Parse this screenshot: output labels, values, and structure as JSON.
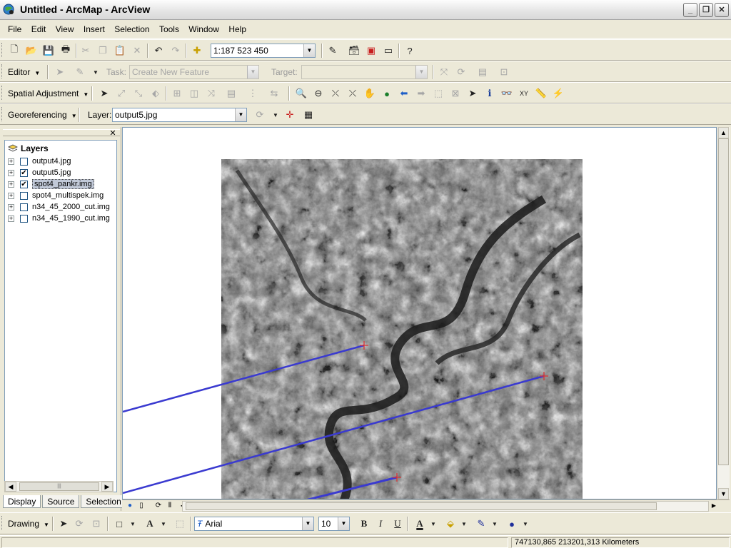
{
  "window": {
    "title": "Untitled - ArcMap - ArcView"
  },
  "window_controls": {
    "minimize": "_",
    "maximize": "❐",
    "close": "✕"
  },
  "menu": [
    "File",
    "Edit",
    "View",
    "Insert",
    "Selection",
    "Tools",
    "Window",
    "Help"
  ],
  "standard_toolbar": {
    "scale": "1:187 523 450"
  },
  "editor_toolbar": {
    "editor_label": "Editor",
    "task_label": "Task:",
    "task_value": "Create New Feature",
    "target_label": "Target:",
    "target_value": ""
  },
  "spatial_adjustment_toolbar": {
    "label": "Spatial Adjustment"
  },
  "georeferencing_toolbar": {
    "label": "Georeferencing",
    "layer_label": "Layer:",
    "layer_value": "output5.jpg"
  },
  "toc": {
    "root": "Layers",
    "layers": [
      {
        "name": "output4.jpg",
        "checked": false,
        "selected": false
      },
      {
        "name": "output5.jpg",
        "checked": true,
        "selected": false
      },
      {
        "name": "spot4_pankr.img",
        "checked": true,
        "selected": true
      },
      {
        "name": "spot4_multispek.img",
        "checked": false,
        "selected": false
      },
      {
        "name": "n34_45_2000_cut.img",
        "checked": false,
        "selected": false
      },
      {
        "name": "n34_45_1990_cut.img",
        "checked": false,
        "selected": false
      }
    ],
    "tabs": [
      "Display",
      "Source",
      "Selection"
    ],
    "active_tab": "Display"
  },
  "map": {
    "link_color": "#3a3ad0",
    "raster_layer": "spot4_pankr.img"
  },
  "drawing_toolbar": {
    "label": "Drawing",
    "font": "Arial",
    "font_size": "10",
    "bold": "B",
    "italic": "I",
    "underline": "U",
    "font_color_label": "A"
  },
  "status": {
    "coordinates": "747130,865  213201,313 Kilometers"
  },
  "colors": {
    "chrome": "#ece9d8",
    "selection": "#c1c9d8",
    "link_lines": "#3a3ad0"
  }
}
